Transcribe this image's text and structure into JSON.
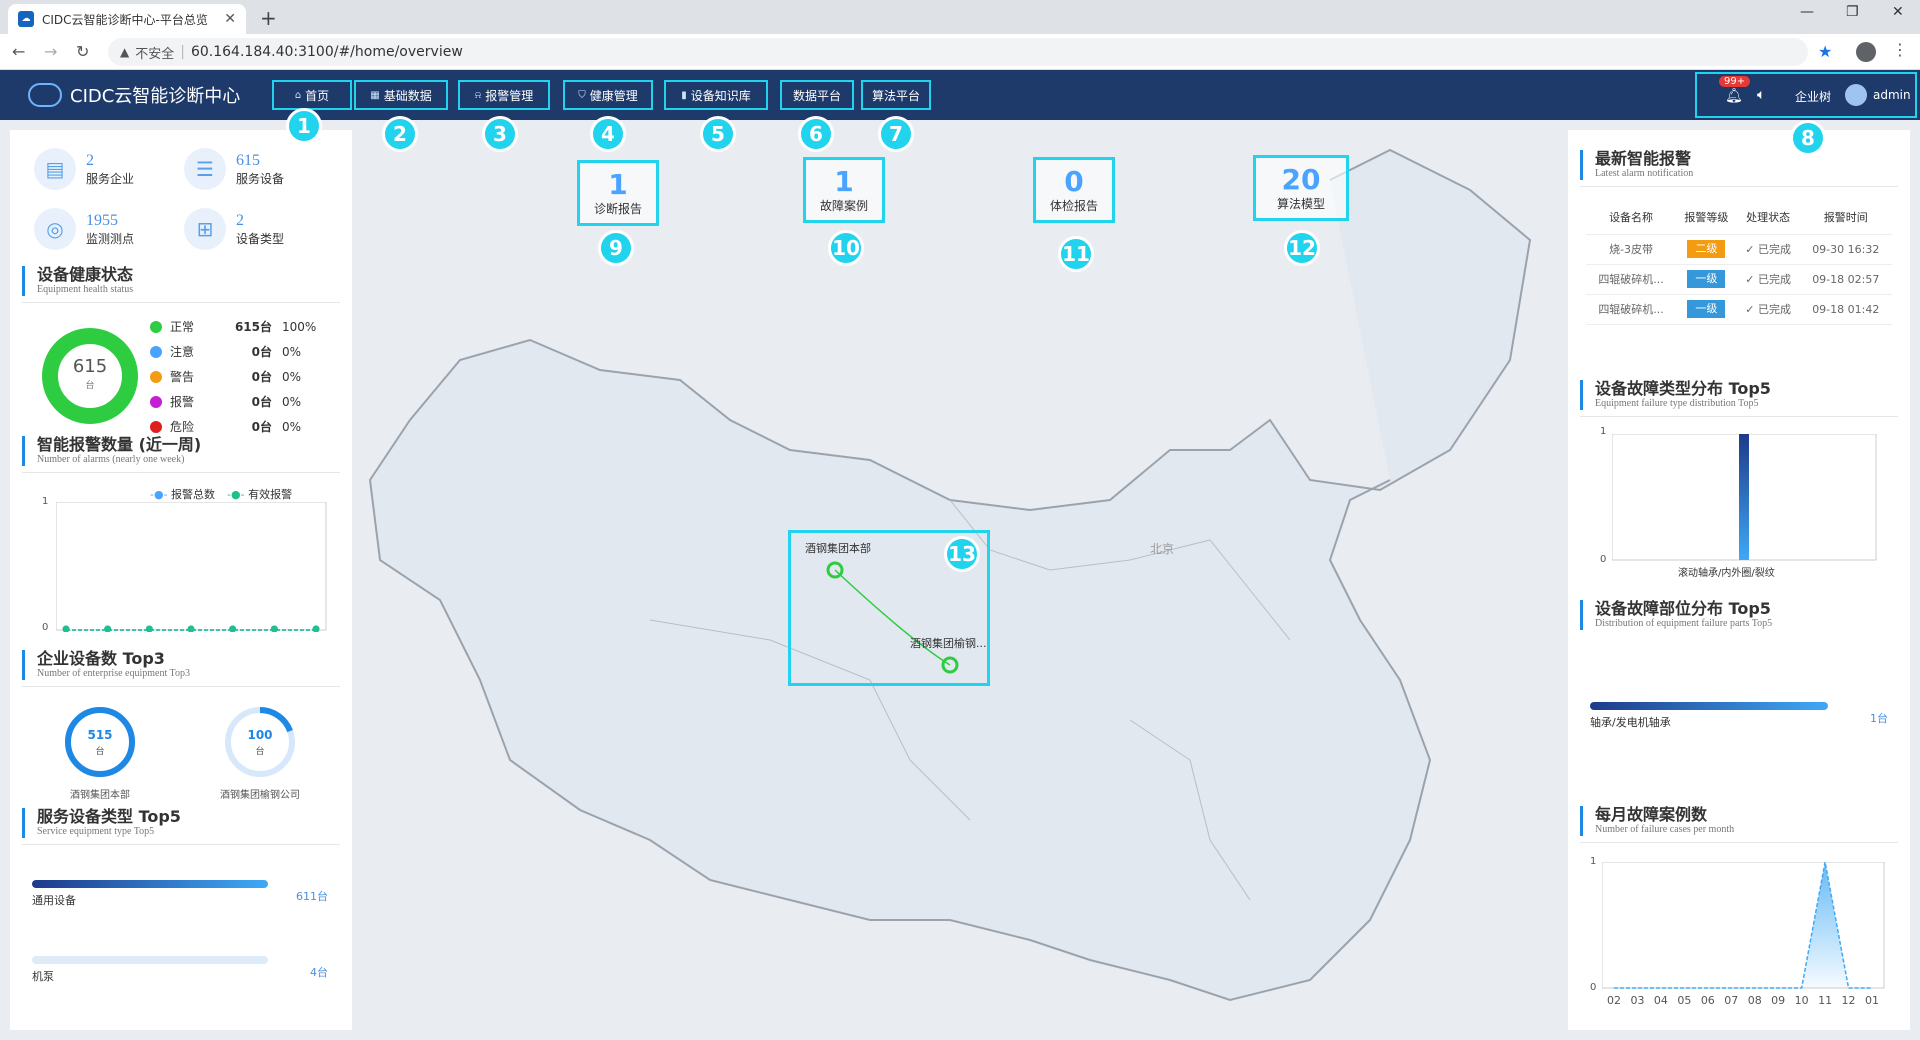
{
  "browser": {
    "tab_title": "CIDC云智能诊断中心-平台总览",
    "url_warning": "不安全",
    "url": "60.164.184.40:3100/#/home/overview"
  },
  "header": {
    "logo_text": "CIDC云智能诊断中心",
    "nav": [
      "首页",
      "基础数据",
      "报警管理",
      "健康管理",
      "设备知识库",
      "数据平台",
      "算法平台"
    ],
    "notification_badge": "99+",
    "org_label": "企业树",
    "user": "admin"
  },
  "markers": [
    "1",
    "2",
    "3",
    "4",
    "5",
    "6",
    "7",
    "8",
    "9",
    "10",
    "11",
    "12",
    "13"
  ],
  "left": {
    "kpis": [
      {
        "value": "2",
        "label": "服务企业",
        "icon": "chart-icon"
      },
      {
        "value": "615",
        "label": "服务设备",
        "icon": "server-icon"
      },
      {
        "value": "1955",
        "label": "监测测点",
        "icon": "target-icon"
      },
      {
        "value": "2",
        "label": "设备类型",
        "icon": "grid-icon"
      }
    ],
    "health": {
      "title": "设备健康状态",
      "subtitle": "Equipment health status",
      "total": "615",
      "unit": "台",
      "rows": [
        {
          "name": "正常",
          "count": "615台",
          "pct": "100%",
          "color": "#2ecc40"
        },
        {
          "name": "注意",
          "count": "0台",
          "pct": "0%",
          "color": "#4aa3ff"
        },
        {
          "name": "警告",
          "count": "0台",
          "pct": "0%",
          "color": "#f39c12"
        },
        {
          "name": "报警",
          "count": "0台",
          "pct": "0%",
          "color": "#c51fd6"
        },
        {
          "name": "危险",
          "count": "0台",
          "pct": "0%",
          "color": "#e01e1e"
        }
      ]
    },
    "alarms_week": {
      "title": "智能报警数量 (近一周)",
      "subtitle": "Number of alarms (nearly one week)",
      "legend": [
        "报警总数",
        "有效报警"
      ],
      "y_top": "1",
      "y_bottom": "0"
    },
    "enterprise": {
      "title": "企业设备数 Top3",
      "subtitle": "Number of enterprise equipment Top3",
      "items": [
        {
          "value": "515",
          "unit": "台",
          "name": "酒钢集团本部"
        },
        {
          "value": "100",
          "unit": "台",
          "name": "酒钢集团榆钢公司"
        }
      ]
    },
    "service_types": {
      "title": "服务设备类型 Top5",
      "subtitle": "Service equipment type Top5",
      "items": [
        {
          "name": "通用设备",
          "value": "611台"
        },
        {
          "name": "机泵",
          "value": "4台"
        }
      ]
    }
  },
  "map": {
    "stats": [
      {
        "value": "1",
        "label": "诊断报告"
      },
      {
        "value": "1",
        "label": "故障案例"
      },
      {
        "value": "0",
        "label": "体检报告"
      },
      {
        "value": "20",
        "label": "算法模型"
      }
    ],
    "city_label": "北京",
    "route_from": "酒钢集团本部",
    "route_to": "酒钢集团榆钢..."
  },
  "right": {
    "alarms": {
      "title": "最新智能报警",
      "subtitle": "Latest alarm notification",
      "headers": [
        "设备名称",
        "报警等级",
        "处理状态",
        "报警时间"
      ],
      "rows": [
        {
          "name": "烧-3皮带",
          "level": "二级",
          "level_color": "orange",
          "status": "已完成",
          "time": "09-30 16:32"
        },
        {
          "name": "四辊破碎机...",
          "level": "一级",
          "level_color": "blue",
          "status": "已完成",
          "time": "09-18 02:57"
        },
        {
          "name": "四辊破碎机...",
          "level": "一级",
          "level_color": "blue",
          "status": "已完成",
          "time": "09-18 01:42"
        }
      ]
    },
    "fault_types": {
      "title": "设备故障类型分布 Top5",
      "subtitle": "Equipment failure type distribution Top5",
      "y_top": "1",
      "y_bottom": "0",
      "category": "滚动轴承/内外圈/裂纹"
    },
    "fault_parts": {
      "title": "设备故障部位分布 Top5",
      "subtitle": "Distribution of equipment failure parts Top5",
      "item": "轴承/发电机轴承",
      "value": "1台"
    },
    "monthly": {
      "title": "每月故障案例数",
      "subtitle": "Number of failure cases per month",
      "y_top": "1",
      "y_bottom": "0",
      "months": [
        "02",
        "03",
        "04",
        "05",
        "06",
        "07",
        "08",
        "09",
        "10",
        "11",
        "12",
        "01"
      ]
    }
  },
  "chart_data": [
    {
      "type": "pie",
      "title": "设备健康状态",
      "categories": [
        "正常",
        "注意",
        "警告",
        "报警",
        "危险"
      ],
      "values": [
        615,
        0,
        0,
        0,
        0
      ]
    },
    {
      "type": "line",
      "title": "智能报警数量 (近一周)",
      "series": [
        {
          "name": "报警总数",
          "values": [
            0,
            0,
            0,
            0,
            0,
            0,
            0
          ]
        },
        {
          "name": "有效报警",
          "values": [
            0,
            0,
            0,
            0,
            0,
            0,
            0
          ]
        }
      ],
      "ylim": [
        0,
        1
      ]
    },
    {
      "type": "bar",
      "title": "设备故障类型分布 Top5",
      "categories": [
        "滚动轴承/内外圈/裂纹"
      ],
      "values": [
        1
      ],
      "ylim": [
        0,
        1
      ]
    },
    {
      "type": "area",
      "title": "每月故障案例数",
      "categories": [
        "02",
        "03",
        "04",
        "05",
        "06",
        "07",
        "08",
        "09",
        "10",
        "11",
        "12",
        "01"
      ],
      "values": [
        0,
        0,
        0,
        0,
        0,
        0,
        0,
        0,
        0,
        1,
        0,
        0
      ],
      "ylim": [
        0,
        1
      ]
    }
  ]
}
